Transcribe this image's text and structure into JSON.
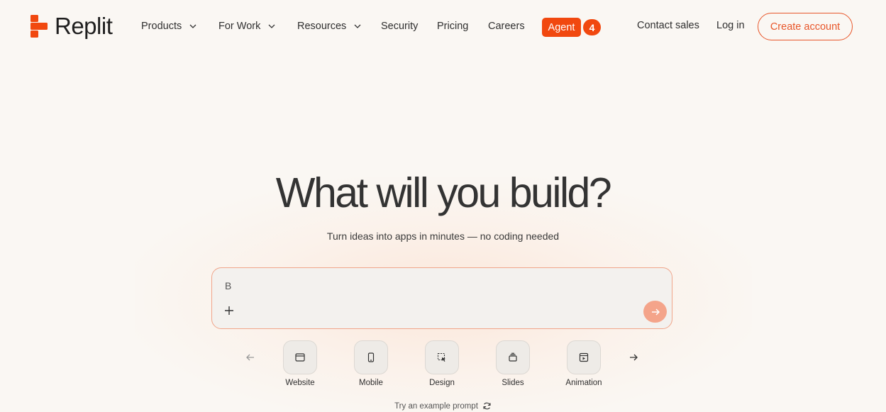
{
  "brand": {
    "name": "Replit",
    "accent": "#f1480f"
  },
  "nav": {
    "items": [
      {
        "label": "Products",
        "has_dropdown": true
      },
      {
        "label": "For Work",
        "has_dropdown": true
      },
      {
        "label": "Resources",
        "has_dropdown": true
      },
      {
        "label": "Security",
        "has_dropdown": false
      },
      {
        "label": "Pricing",
        "has_dropdown": false
      },
      {
        "label": "Careers",
        "has_dropdown": false
      }
    ],
    "agent_label": "Agent",
    "agent_badge": "4",
    "contact_label": "Contact sales",
    "login_label": "Log in",
    "create_account_label": "Create account"
  },
  "hero": {
    "title": "What will you build?",
    "subtitle": "Turn ideas into apps in minutes — no coding needed"
  },
  "prompt": {
    "value": "B",
    "attach_icon": "plus-icon",
    "send_icon": "arrow-right-icon"
  },
  "categories": [
    {
      "label": "Website",
      "icon": "browser-window-icon"
    },
    {
      "label": "Mobile",
      "icon": "phone-icon"
    },
    {
      "label": "Design",
      "icon": "select-cursor-icon"
    },
    {
      "label": "Slides",
      "icon": "slides-stack-icon"
    },
    {
      "label": "Animation",
      "icon": "video-play-icon"
    }
  ],
  "example_prompt_label": "Try an example prompt"
}
